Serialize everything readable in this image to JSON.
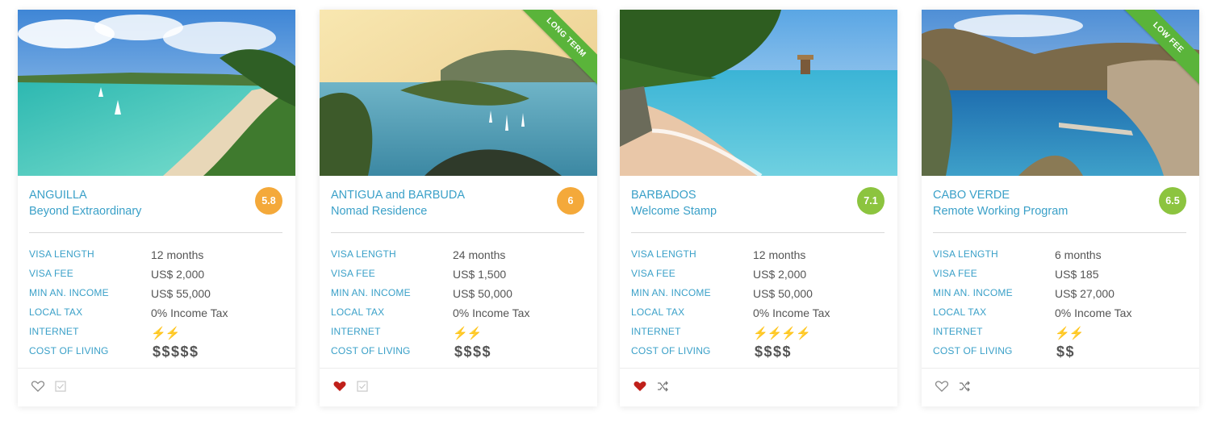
{
  "labels": {
    "visa_length": "VISA LENGTH",
    "visa_fee": "VISA FEE",
    "min_income": "MIN AN. INCOME",
    "local_tax": "LOCAL TAX",
    "internet": "INTERNET",
    "cost_of_living": "COST OF LIVING"
  },
  "colors": {
    "accent": "#3aa0c8",
    "score_orange": "#f4a93a",
    "score_green": "#8cc43f",
    "ribbon": "#5ab43a",
    "heart_red": "#c0201a"
  },
  "cards": [
    {
      "country": "ANGUILLA",
      "program": "Beyond Extraordinary",
      "score": "5.8",
      "score_color": "#f4a93a",
      "ribbon": "",
      "visa_length": "12 months",
      "visa_fee": "US$ 2,000",
      "min_income": "US$ 55,000",
      "local_tax": "0% Income Tax",
      "internet": "⚡⚡",
      "cost_of_living": "$$$$$",
      "favorited": false,
      "footer_icon": "checkbox-icon"
    },
    {
      "country": "ANTIGUA and BARBUDA",
      "program": "Nomad Residence",
      "score": "6",
      "score_color": "#f4a93a",
      "ribbon": "LONG TERM",
      "visa_length": "24 months",
      "visa_fee": "US$ 1,500",
      "min_income": "US$ 50,000",
      "local_tax": "0% Income Tax",
      "internet": "⚡⚡",
      "cost_of_living": "$$$$",
      "favorited": true,
      "footer_icon": "checkbox-icon"
    },
    {
      "country": "BARBADOS",
      "program": "Welcome Stamp",
      "score": "7.1",
      "score_color": "#8cc43f",
      "ribbon": "",
      "visa_length": "12 months",
      "visa_fee": "US$ 2,000",
      "min_income": "US$ 50,000",
      "local_tax": "0% Income Tax",
      "internet": "⚡⚡⚡⚡",
      "cost_of_living": "$$$$",
      "favorited": true,
      "footer_icon": "shuffle-icon"
    },
    {
      "country": "CABO VERDE",
      "program": "Remote Working Program",
      "score": "6.5",
      "score_color": "#8cc43f",
      "ribbon": "LOW FEE",
      "visa_length": "6 months",
      "visa_fee": "US$ 185",
      "min_income": "US$ 27,000",
      "local_tax": "0% Income Tax",
      "internet": "⚡⚡",
      "cost_of_living": "$$",
      "favorited": false,
      "footer_icon": "shuffle-icon"
    }
  ]
}
